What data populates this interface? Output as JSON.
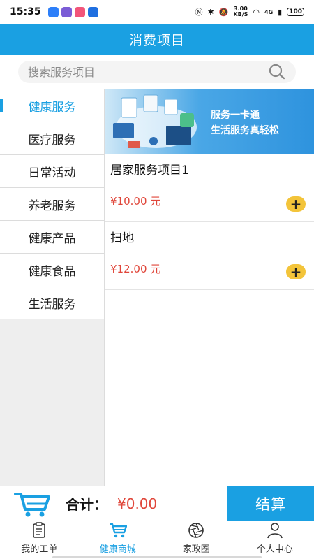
{
  "status_bar": {
    "time": "15:35",
    "speed_top": "3.00",
    "speed_unit": "KB/S",
    "network": "4G",
    "battery": "100"
  },
  "header": {
    "title": "消费项目"
  },
  "search": {
    "placeholder": "搜索服务项目"
  },
  "sidebar": {
    "items": [
      {
        "label": "健康服务",
        "active": true
      },
      {
        "label": "医疗服务"
      },
      {
        "label": "日常活动"
      },
      {
        "label": "养老服务"
      },
      {
        "label": "健康产品"
      },
      {
        "label": "健康食品"
      },
      {
        "label": "生活服务"
      }
    ]
  },
  "banner": {
    "line1": "服务一卡通",
    "line2": "生活服务真轻松"
  },
  "products": [
    {
      "name": "居家服务项目1",
      "price": "¥10.00 元",
      "add_label": "+"
    },
    {
      "name": "扫地",
      "price": "¥12.00 元",
      "add_label": "+"
    }
  ],
  "cart": {
    "total_label": "合计：",
    "total_value": "¥0.00",
    "checkout_label": "结算"
  },
  "tabs": [
    {
      "label": "我的工单",
      "icon": "clipboard-icon"
    },
    {
      "label": "健康商城",
      "icon": "cart-icon",
      "active": true
    },
    {
      "label": "家政圈",
      "icon": "aperture-icon"
    },
    {
      "label": "个人中心",
      "icon": "person-icon"
    }
  ],
  "colors": {
    "primary": "#1aa0e2",
    "price": "#e0463a",
    "add_button": "#f3c43a"
  }
}
